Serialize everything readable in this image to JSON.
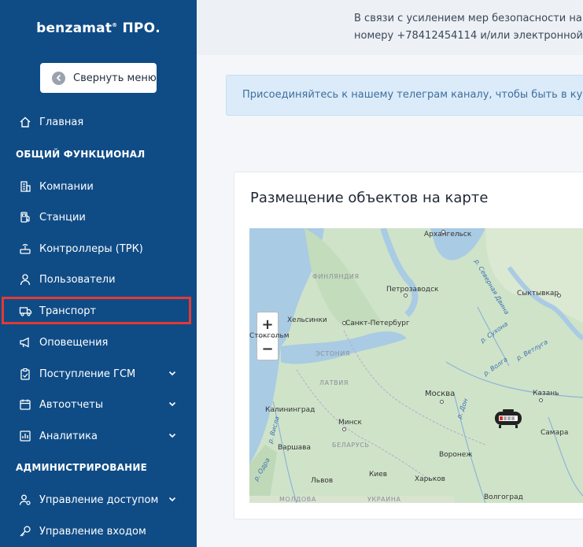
{
  "sidebar": {
    "logo": "benzamat",
    "logo_mark": "®",
    "logo_suffix": "ПРО.",
    "collapse_label": "Свернуть меню",
    "items": {
      "home": "Главная",
      "section_general": "ОБЩИЙ ФУНКЦИОНАЛ",
      "companies": "Компании",
      "stations": "Станции",
      "controllers": "Контроллеры (ТРК)",
      "users": "Пользователи",
      "transport": "Транспорт",
      "notifications": "Оповещения",
      "fuel_receipt": "Поступление ГСМ",
      "autoreports": "Автоотчеты",
      "analytics": "Аналитика",
      "section_admin": "АДМИНИСТРИРОВАНИЕ",
      "access_mgmt": "Управление доступом",
      "login_mgmt": "Управление входом"
    }
  },
  "banner": {
    "line1": "В связи с усилением мер безопасности на",
    "line2": "номеру +78412454114 и/или электронной"
  },
  "telegram_alert": "Присоединяйтесь к нашему телеграм каналу, чтобы быть в кур",
  "map_card": {
    "title": "Размещение объектов на карте",
    "zoom_in": "+",
    "zoom_out": "−",
    "labels": {
      "arkhangelsk": "Архангельск",
      "finland": "ФИНЛЯНДИЯ",
      "petrozavodsk": "Петрозаводск",
      "syktyvkar": "Сыктывкар",
      "helsinki": "Хельсинки",
      "spb": "Санкт-Петербург",
      "stockholm": "Стокгольм",
      "estonia": "ЭСТОНИЯ",
      "latvia": "ЛАТВИЯ",
      "moscow": "Москва",
      "kazan": "Казань",
      "kaliningrad": "Калининград",
      "minsk": "Минск",
      "samara": "Самара",
      "warsaw": "Варшава",
      "belarus": "БЕЛАРУСЬ",
      "voronezh": "Воронеж",
      "lviv": "Львов",
      "kyiv": "Киев",
      "kharkov": "Харьков",
      "volgograd": "Волгоград",
      "ukraine": "УКРАИНА",
      "moldova": "МОЛДОВА",
      "r_sev_dvina": "р. Северная Двина",
      "r_sukhona": "р. Сухона",
      "r_vetluga": "р. Ветлуга",
      "r_volga": "р. Волга",
      "r_don": "р. Дон",
      "r_visla": "р. Висла",
      "r_odra": "р. Одра"
    }
  },
  "colors": {
    "sidebar_bg": "#0f4c86",
    "highlight": "#e53935",
    "alert_bg": "#dcebf9"
  }
}
